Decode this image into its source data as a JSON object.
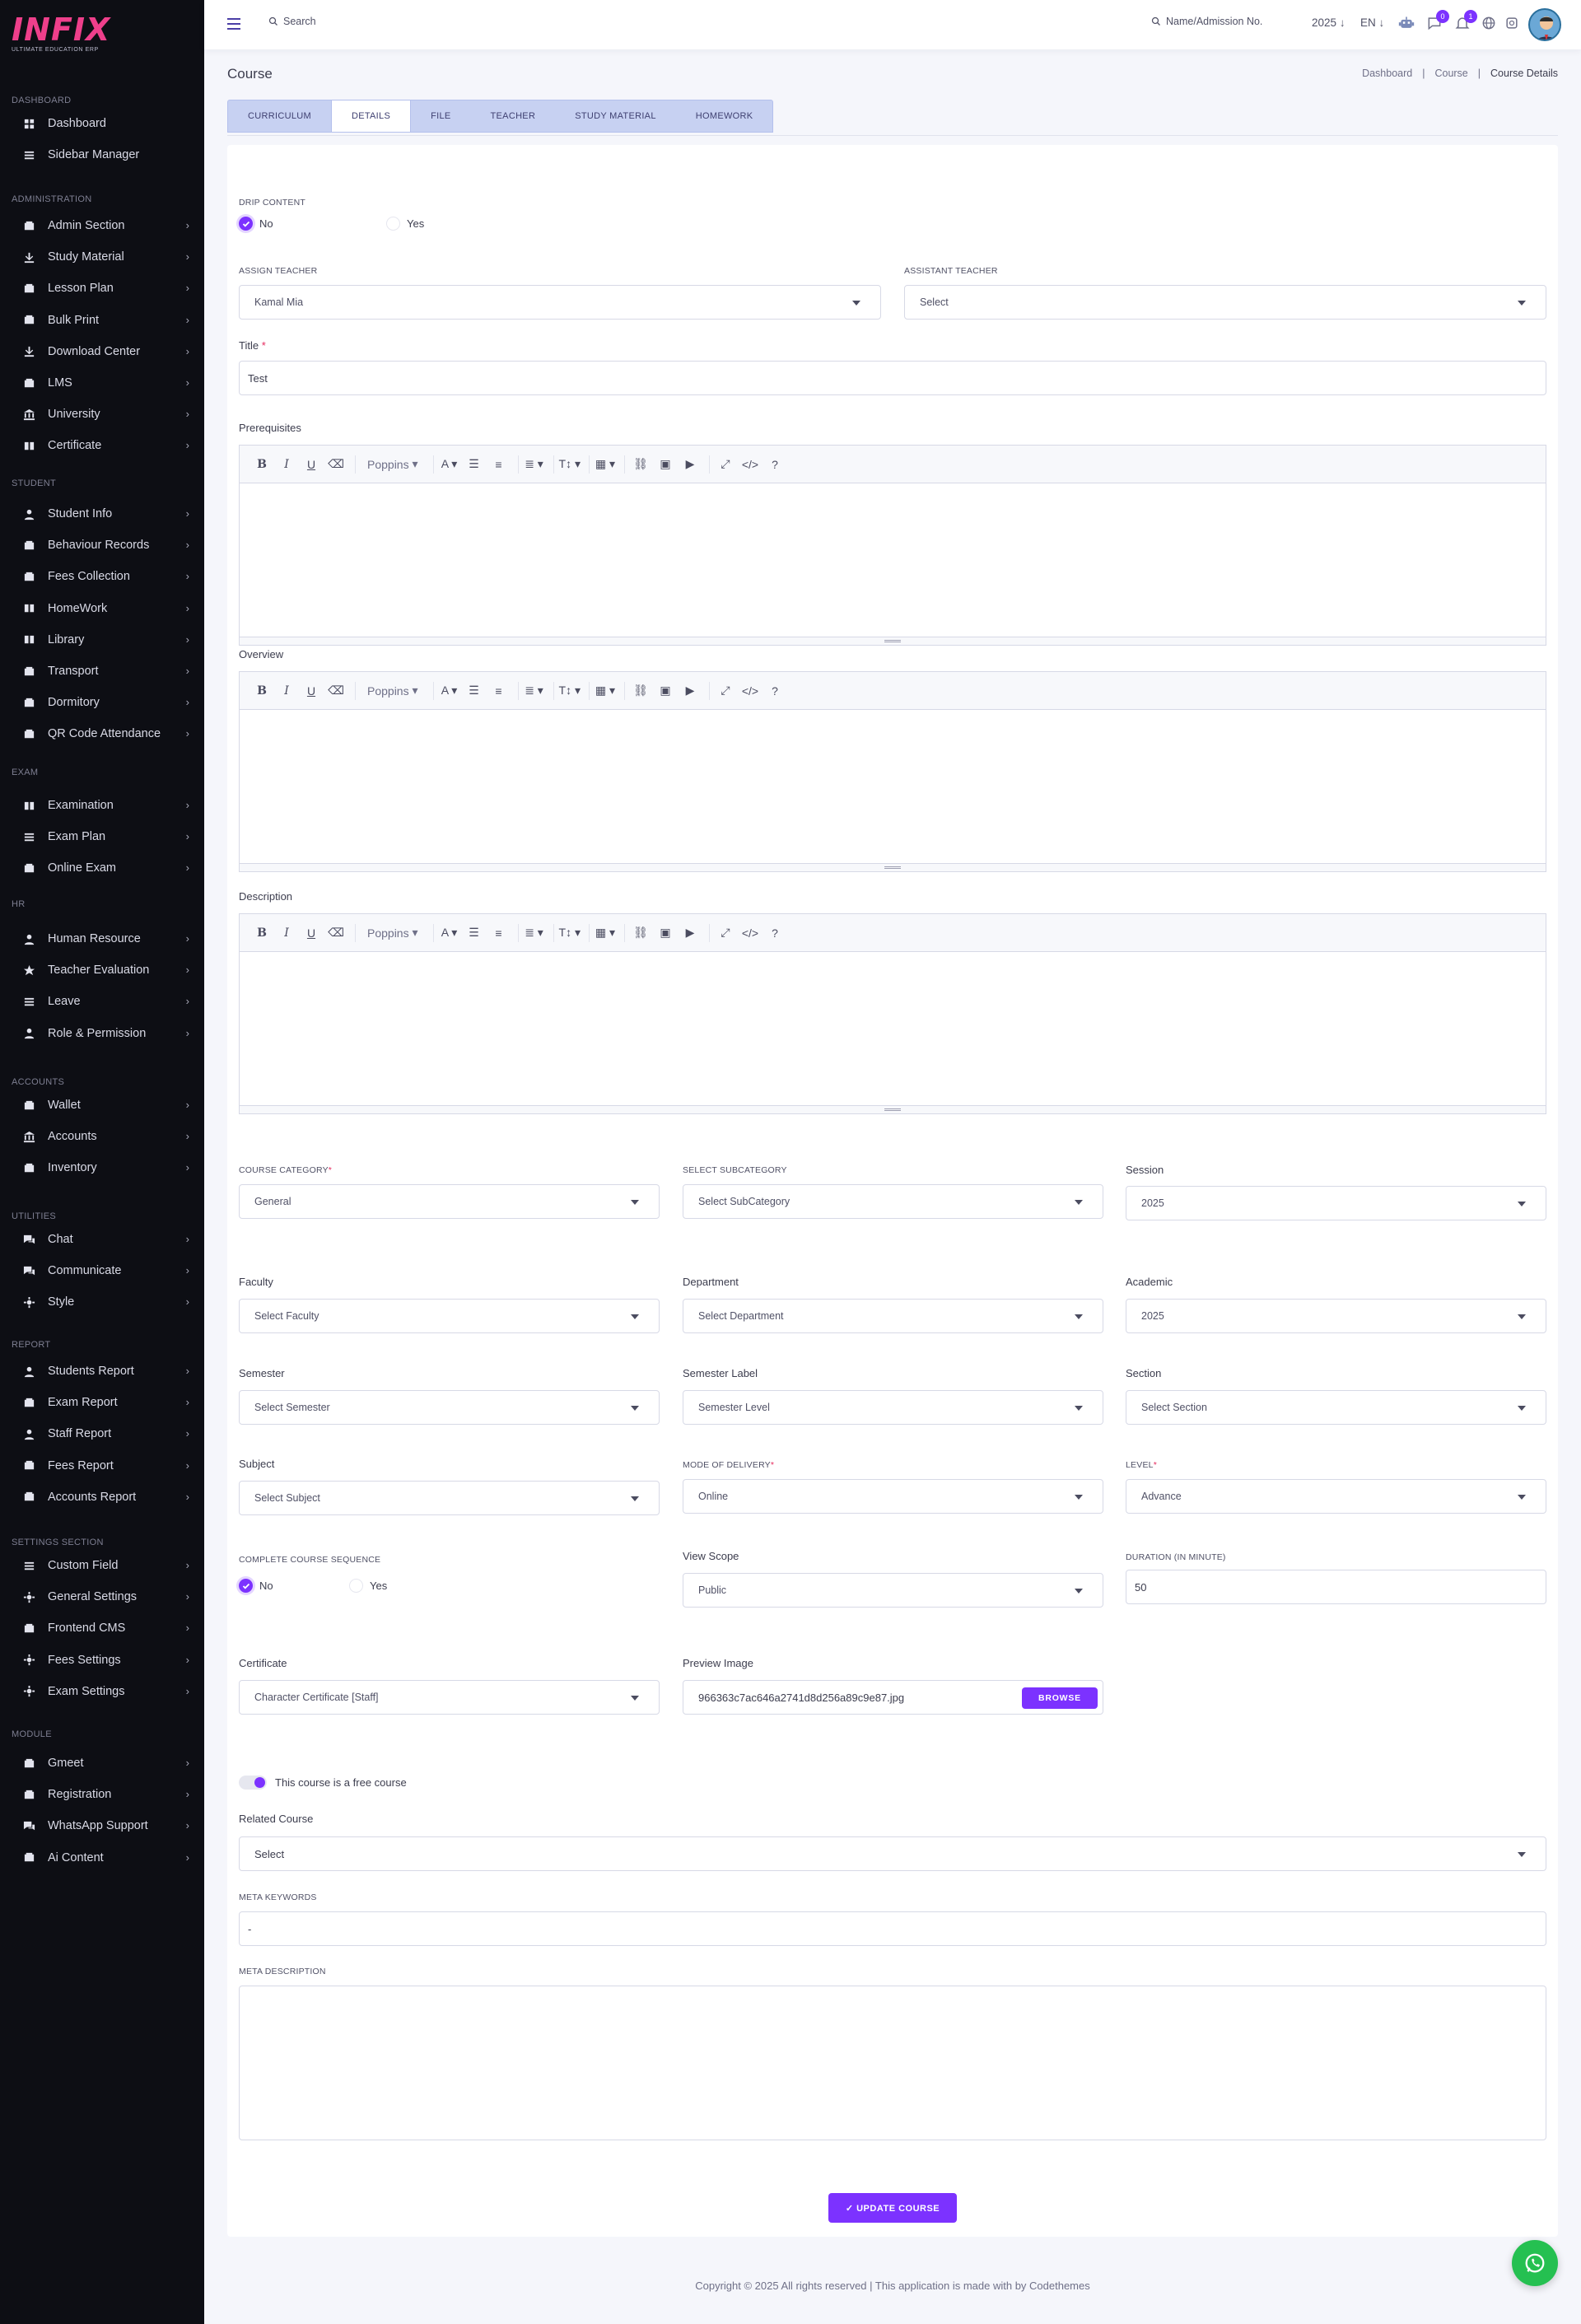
{
  "brand": {
    "logo": "INFIX",
    "tagline": "ULTIMATE EDUCATION ERP"
  },
  "sidebar": {
    "sections": [
      {
        "title": "DASHBOARD",
        "items": [
          "Dashboard",
          "Sidebar Manager"
        ]
      },
      {
        "title": "ADMINISTRATION",
        "items": [
          "Admin Section",
          "Study Material",
          "Lesson Plan",
          "Bulk Print",
          "Download Center",
          "LMS",
          "University",
          "Certificate"
        ]
      },
      {
        "title": "STUDENT",
        "items": [
          "Student Info",
          "Behaviour Records",
          "Fees Collection",
          "HomeWork",
          "Library",
          "Transport",
          "Dormitory",
          "QR Code Attendance"
        ]
      },
      {
        "title": "EXAM",
        "items": [
          "Examination",
          "Exam Plan",
          "Online Exam"
        ]
      },
      {
        "title": "HR",
        "items": [
          "Human Resource",
          "Teacher Evaluation",
          "Leave",
          "Role & Permission"
        ]
      },
      {
        "title": "ACCOUNTS",
        "items": [
          "Wallet",
          "Accounts",
          "Inventory"
        ]
      },
      {
        "title": "UTILITIES",
        "items": [
          "Chat",
          "Communicate",
          "Style"
        ]
      },
      {
        "title": "REPORT",
        "items": [
          "Students Report",
          "Exam Report",
          "Staff Report",
          "Fees Report",
          "Accounts Report"
        ]
      },
      {
        "title": "SETTINGS SECTION",
        "items": [
          "Custom Field",
          "General Settings",
          "Frontend CMS",
          "Fees Settings",
          "Exam Settings"
        ]
      },
      {
        "title": "MODULE",
        "items": [
          "Gmeet",
          "Registration",
          "WhatsApp Support",
          "Ai Content"
        ]
      }
    ]
  },
  "header": {
    "search": "Search",
    "student_search": "Name/Admission No.",
    "year": "2025",
    "lang": "EN",
    "chat_badge": "0",
    "notif_badge": "1"
  },
  "page": {
    "title": "Course",
    "breadcrumb": [
      "Dashboard",
      "Course",
      "Course Details"
    ],
    "tabs": [
      "CURRICULUM",
      "DETAILS",
      "FILE",
      "TEACHER",
      "STUDY MATERIAL",
      "HOMEWORK"
    ]
  },
  "form": {
    "drip_label": "DRIP CONTENT",
    "drip_no": "No",
    "drip_yes": "Yes",
    "assign_teacher_label": "ASSIGN TEACHER",
    "assign_teacher_value": "Kamal Mia",
    "assistant_teacher_label": "ASSISTANT TEACHER",
    "assistant_teacher_value": "Select",
    "title_label": "Title",
    "req": "*",
    "title_value": "Test",
    "prerequisites_label": "Prerequisites",
    "overview_label": "Overview",
    "description_label": "Description",
    "editor_font": "Poppins",
    "course_category_label": "COURSE CATEGORY",
    "course_category_value": "General",
    "subcategory_label": "SELECT SUBCATEGORY",
    "subcategory_value": "Select SubCategory",
    "session_label": "Session",
    "session_value": "2025",
    "faculty_label": "Faculty",
    "faculty_value": "Select Faculty",
    "department_label": "Department",
    "department_value": "Select Department",
    "academic_label": "Academic",
    "academic_value": "2025",
    "semester_label": "Semester",
    "semester_value": "Select Semester",
    "semester_label_label": "Semester Label",
    "semester_label_value": "Semester Level",
    "section_label": "Section",
    "section_value": "Select Section",
    "subject_label": "Subject",
    "subject_value": "Select Subject",
    "mode_label": "MODE OF DELIVERY",
    "mode_value": "Online",
    "level_label": "LEVEL",
    "level_value": "Advance",
    "sequence_label": "COMPLETE COURSE SEQUENCE",
    "sequence_no": "No",
    "sequence_yes": "Yes",
    "view_scope_label": "View Scope",
    "view_scope_value": "Public",
    "duration_label": "DURATION (IN MINUTE)",
    "duration_value": "50",
    "certificate_label": "Certificate",
    "certificate_value": "Character Certificate [Staff]",
    "preview_label": "Preview Image",
    "preview_value": "966363c7ac646a2741d8d256a89c9e87.jpg",
    "browse": "BROWSE",
    "free_course": "This course is a free course",
    "related_label": "Related Course",
    "related_value": "Select",
    "meta_keywords_label": "META KEYWORDS",
    "meta_keywords_value": "-",
    "meta_description_label": "META DESCRIPTION",
    "update": "✓ UPDATE COURSE"
  },
  "footer": "Copyright © 2025 All rights reserved | This application is made with by Codethemes"
}
